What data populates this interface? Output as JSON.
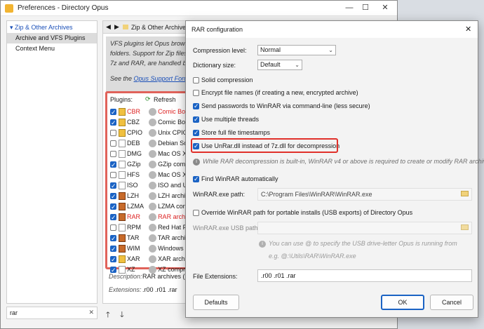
{
  "pref": {
    "title": "Preferences - Directory Opus",
    "tree": [
      {
        "label": "▾ Zip & Other Archives"
      },
      {
        "label": "Archive and VFS Plugins"
      },
      {
        "label": "Context Menu"
      }
    ],
    "search_value": "rar",
    "breadcrumb": "Zip & Other Archives /",
    "help_lines": [
      "VFS plugins let Opus browse i",
      "folders. Support for Zip files i",
      "7z and RAR, are handled by p"
    ],
    "help_see": "See the",
    "help_link": "Opus Support Forum",
    "plugins_label": "Plugins:",
    "refresh_label": "Refresh",
    "plugins": [
      {
        "name": "CBR",
        "desc": "Comic Bo",
        "checked": true,
        "red": true
      },
      {
        "name": "CBZ",
        "desc": "Comic Boo",
        "checked": true,
        "red": false
      },
      {
        "name": "CPIO",
        "desc": "Unix CPIO",
        "checked": false,
        "red": false
      },
      {
        "name": "DEB",
        "desc": "Debian So",
        "checked": false,
        "red": false
      },
      {
        "name": "DMG",
        "desc": "Mac OS X",
        "checked": false,
        "red": false
      },
      {
        "name": "GZip",
        "desc": "GZip com",
        "checked": true,
        "red": false
      },
      {
        "name": "HFS",
        "desc": "Mac OS X",
        "checked": false,
        "red": false
      },
      {
        "name": "ISO",
        "desc": "ISO and U",
        "checked": true,
        "red": false
      },
      {
        "name": "LZH",
        "desc": "LZH archi",
        "checked": true,
        "red": false
      },
      {
        "name": "LZMA",
        "desc": "LZMA con",
        "checked": true,
        "red": false
      },
      {
        "name": "RAR",
        "desc": "RAR archi",
        "checked": true,
        "red": true
      },
      {
        "name": "RPM",
        "desc": "Red Hat P",
        "checked": false,
        "red": false
      },
      {
        "name": "TAR",
        "desc": "TAR archi",
        "checked": true,
        "red": false
      },
      {
        "name": "WIM",
        "desc": "Windows",
        "checked": true,
        "red": false
      },
      {
        "name": "XAR",
        "desc": "XAR archi",
        "checked": true,
        "red": false
      },
      {
        "name": "XZ",
        "desc": "XZ compr",
        "checked": true,
        "red": false
      }
    ],
    "description_label": "Description:",
    "description_value": "RAR archives (re",
    "extensions_label": "Extensions:",
    "extensions_value": ".r00 .r01 .rar"
  },
  "dialog": {
    "title": "RAR configuration",
    "compression_label": "Compression level:",
    "compression_value": "Normal",
    "dictionary_label": "Dictionary size:",
    "dictionary_value": "Default",
    "options": [
      {
        "label": "Solid compression",
        "checked": false
      },
      {
        "label": "Encrypt file names (if creating a new, encrypted archive)",
        "checked": false
      },
      {
        "label": "Send passwords to WinRAR via command-line (less secure)",
        "checked": true
      },
      {
        "label": "Use multiple threads",
        "checked": true
      },
      {
        "label": "Store full file timestamps",
        "checked": true
      },
      {
        "label": "Use UnRar.dll instead of 7z.dll for decompression",
        "checked": true
      }
    ],
    "decomp_note": "While RAR decompression is built-in, WinRAR v4 or above is required to create or modify RAR archives",
    "find_winrar_label": "Find WinRAR automatically",
    "winrar_path_label": "WinRAR.exe path:",
    "winrar_path_value": "C:\\Program Files\\WinRAR\\WinRAR.exe",
    "override_label": "Override WinRAR path for portable installs (USB exports) of Directory Opus",
    "usb_path_label": "WinRAR.exe USB path:",
    "usb_note_1": "You can use @ to specify the USB drive-letter Opus is running from",
    "usb_note_2": "e.g. @:\\Utils\\RAR\\WinRAR.exe",
    "file_ext_label": "File Extensions:",
    "file_ext_value": ".r00 .r01 .rar",
    "defaults_label": "Defaults",
    "ok_label": "OK",
    "cancel_label": "Cancel"
  }
}
